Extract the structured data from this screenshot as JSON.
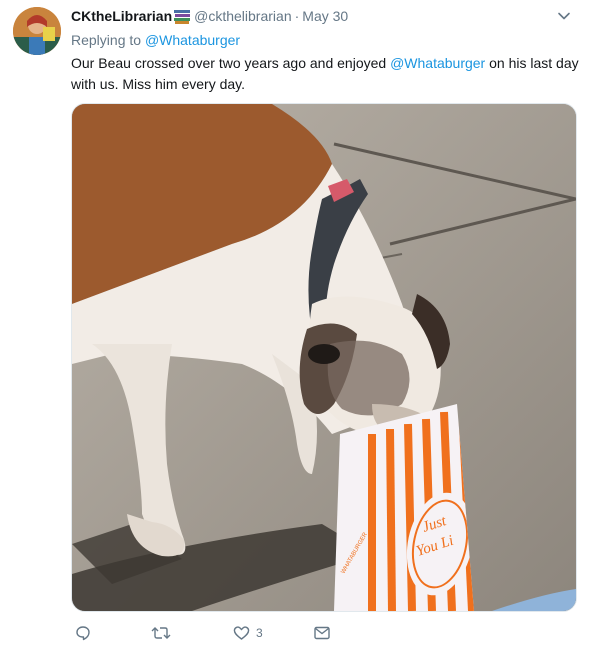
{
  "tweet": {
    "display_name": "CKtheLibrarian",
    "handle": "@ckthelibrarian",
    "separator": "·",
    "date": "May 30",
    "replying_prefix": "Replying to ",
    "replying_handle": "@Whataburger",
    "text_part1": "Our Beau crossed over two years ago and enjoyed ",
    "text_mention": "@Whataburger",
    "text_part2": " on his last day with us. Miss him every day.",
    "bag_text_line1": "Just",
    "bag_text_line2": "You Li",
    "bag_text_small": "WHATABURGER",
    "like_count": "3"
  },
  "colors": {
    "link": "#1b95e0",
    "muted": "#657786",
    "text": "#14171a",
    "bag_stripe": "#f0701d"
  },
  "icons": {
    "caret": "chevron-down-icon",
    "reply": "reply-icon",
    "retweet": "retweet-icon",
    "like": "heart-icon",
    "dm": "envelope-icon"
  }
}
